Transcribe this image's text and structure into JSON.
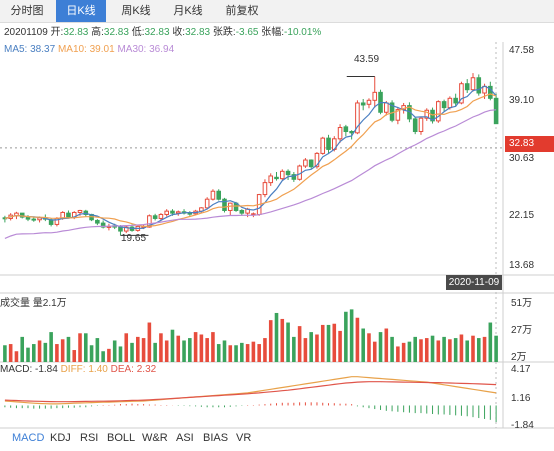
{
  "tabs": [
    "分时图",
    "日K线",
    "周K线",
    "月K线",
    "前复权"
  ],
  "info": {
    "date": "20201109",
    "open_label": "开:",
    "open": "32.83",
    "high_label": "高:",
    "high": "32.83",
    "low_label": "低:",
    "low": "32.83",
    "close_label": "收:",
    "close": "32.83",
    "change_label": "张跌:",
    "change": "-3.65",
    "pct_label": "张幅:",
    "pct": "-10.01%"
  },
  "ma": {
    "ma5": "MA5: 38.37",
    "ma10": "MA10: 39.01",
    "ma30": "MA30: 36.94"
  },
  "price_axis": [
    "47.58",
    "39.10",
    "32.83",
    "30.63",
    "22.15",
    "13.68"
  ],
  "high_marker": "43.59",
  "low_marker": "19.65",
  "date_label": "2020-11-09",
  "volume": {
    "title": "成交量 量2.1万",
    "axis": [
      "51万",
      "27万",
      "2万"
    ]
  },
  "macd": {
    "macd_label": "MACD: -1.84",
    "diff_label": "DIFF: 1.40",
    "dea_label": "DEA: 2.32",
    "axis": [
      "4.17",
      "1.16",
      "-1.84"
    ]
  },
  "indicators": [
    "MACD",
    "KDJ",
    "RSI",
    "BOLL",
    "W&R",
    "ASI",
    "BIAS",
    "VR"
  ],
  "colors": {
    "up": "#e74c3c",
    "down": "#3aa35c",
    "tab_active": "#3d7fd6",
    "ma5": "#4a7fc1",
    "ma10": "#f0a050",
    "ma30": "#b98bd6",
    "current_price": "#e23b2e",
    "date_bg": "#4a4a4a"
  },
  "chart_data": {
    "type": "candlestick",
    "y_range": [
      13.68,
      47.58
    ],
    "candles": [
      [
        22.3,
        22.6,
        21.6,
        22.2
      ],
      [
        22.2,
        23.0,
        21.9,
        22.7
      ],
      [
        22.6,
        23.2,
        22.1,
        23.0
      ],
      [
        23.0,
        23.0,
        22.2,
        22.4
      ],
      [
        22.4,
        22.7,
        21.8,
        22.1
      ],
      [
        22.1,
        22.5,
        21.7,
        22.0
      ],
      [
        22.0,
        22.5,
        21.6,
        22.3
      ],
      [
        22.3,
        22.8,
        21.8,
        22.1
      ],
      [
        22.0,
        22.2,
        21.0,
        21.3
      ],
      [
        21.3,
        22.4,
        21.0,
        22.2
      ],
      [
        22.2,
        23.3,
        22.0,
        23.1
      ],
      [
        23.0,
        23.4,
        22.2,
        22.4
      ],
      [
        22.4,
        23.3,
        22.1,
        23.1
      ],
      [
        23.1,
        23.5,
        22.6,
        23.4
      ],
      [
        23.3,
        23.5,
        22.5,
        22.8
      ],
      [
        22.8,
        22.9,
        21.8,
        22.0
      ],
      [
        21.9,
        22.1,
        21.2,
        21.5
      ],
      [
        21.5,
        21.9,
        20.7,
        20.9
      ],
      [
        20.9,
        21.4,
        20.4,
        21.0
      ],
      [
        21.1,
        21.4,
        20.6,
        20.9
      ],
      [
        20.9,
        21.2,
        19.65,
        20.3
      ],
      [
        20.3,
        21.1,
        20.0,
        20.9
      ],
      [
        20.9,
        21.3,
        20.2,
        20.4
      ],
      [
        20.4,
        21.2,
        20.2,
        21.0
      ],
      [
        21.0,
        21.3,
        20.6,
        21.0
      ],
      [
        20.9,
        22.8,
        20.8,
        22.6
      ],
      [
        22.6,
        22.9,
        21.9,
        22.2
      ],
      [
        22.2,
        23.0,
        21.8,
        22.8
      ],
      [
        22.8,
        23.6,
        22.5,
        23.3
      ],
      [
        23.3,
        23.6,
        22.6,
        23.0
      ],
      [
        23.0,
        23.4,
        22.6,
        23.2
      ],
      [
        23.2,
        23.6,
        22.8,
        23.0
      ],
      [
        23.0,
        23.3,
        22.6,
        22.9
      ],
      [
        22.9,
        23.5,
        22.8,
        23.3
      ],
      [
        23.3,
        23.9,
        23.0,
        23.8
      ],
      [
        23.8,
        25.4,
        23.6,
        25.1
      ],
      [
        25.1,
        26.6,
        24.9,
        26.3
      ],
      [
        26.3,
        26.6,
        24.9,
        25.1
      ],
      [
        25.1,
        25.3,
        23.1,
        23.4
      ],
      [
        23.4,
        24.6,
        22.7,
        24.5
      ],
      [
        24.5,
        24.7,
        23.2,
        23.4
      ],
      [
        23.4,
        23.6,
        22.6,
        23.0
      ],
      [
        23.0,
        23.8,
        22.4,
        23.6
      ],
      [
        22.8,
        23.1,
        22.4,
        22.9
      ],
      [
        22.8,
        25.9,
        22.6,
        25.8
      ],
      [
        25.8,
        28.1,
        25.4,
        27.6
      ],
      [
        27.6,
        29.0,
        27.1,
        28.6
      ],
      [
        28.4,
        29.2,
        27.9,
        28.2
      ],
      [
        28.2,
        29.6,
        28.0,
        29.3
      ],
      [
        29.3,
        29.6,
        28.0,
        28.8
      ],
      [
        28.8,
        29.2,
        27.7,
        28.1
      ],
      [
        28.1,
        30.3,
        27.9,
        30.1
      ],
      [
        30.1,
        31.3,
        29.8,
        31.0
      ],
      [
        31.0,
        31.1,
        29.7,
        30.0
      ],
      [
        30.0,
        32.2,
        29.7,
        32.0
      ],
      [
        32.0,
        34.5,
        31.8,
        34.3
      ],
      [
        34.3,
        34.8,
        31.9,
        32.6
      ],
      [
        32.6,
        34.6,
        32.3,
        34.2
      ],
      [
        34.2,
        36.4,
        33.6,
        35.9
      ],
      [
        36.0,
        36.3,
        34.6,
        35.3
      ],
      [
        35.3,
        35.5,
        34.1,
        35.1
      ],
      [
        35.1,
        40.0,
        34.9,
        39.6
      ],
      [
        39.6,
        40.2,
        38.5,
        39.3
      ],
      [
        39.4,
        40.3,
        38.8,
        40.0
      ],
      [
        40.0,
        43.59,
        38.9,
        41.2
      ],
      [
        41.2,
        41.6,
        37.9,
        38.2
      ],
      [
        38.2,
        39.9,
        37.7,
        39.6
      ],
      [
        39.6,
        40.0,
        36.7,
        37.0
      ],
      [
        37.0,
        39.0,
        36.4,
        38.6
      ],
      [
        38.6,
        39.6,
        38.0,
        39.2
      ],
      [
        39.2,
        39.7,
        36.7,
        37.2
      ],
      [
        37.2,
        37.5,
        34.9,
        35.3
      ],
      [
        35.3,
        37.5,
        34.8,
        37.3
      ],
      [
        37.3,
        38.8,
        36.9,
        38.5
      ],
      [
        38.5,
        38.9,
        36.5,
        36.9
      ],
      [
        36.9,
        40.0,
        36.6,
        39.8
      ],
      [
        39.8,
        40.1,
        38.3,
        38.9
      ],
      [
        38.9,
        40.6,
        38.6,
        40.3
      ],
      [
        40.3,
        41.0,
        39.1,
        39.6
      ],
      [
        39.6,
        42.8,
        39.4,
        42.5
      ],
      [
        42.5,
        43.2,
        41.1,
        41.6
      ],
      [
        41.6,
        44.1,
        41.3,
        43.4
      ],
      [
        43.4,
        43.9,
        40.7,
        41.1
      ],
      [
        41.1,
        42.5,
        40.2,
        42.1
      ],
      [
        42.1,
        42.8,
        40.0,
        40.3
      ],
      [
        40.3,
        41.0,
        36.48,
        36.48
      ]
    ],
    "volume": [
      14,
      15,
      9,
      21,
      12,
      15,
      18,
      16,
      25,
      15,
      19,
      21,
      10,
      24,
      24,
      14,
      20,
      9,
      11,
      18,
      13,
      24,
      16,
      21,
      20,
      33,
      16,
      24,
      18,
      27,
      22,
      18,
      20,
      25,
      23,
      20,
      25,
      15,
      18,
      14,
      14,
      16,
      15,
      17,
      15,
      20,
      35,
      41,
      36,
      33,
      21,
      30,
      20,
      25,
      23,
      31,
      31,
      32,
      26,
      42,
      44,
      37,
      28,
      24,
      17,
      25,
      28,
      21,
      13,
      16,
      17,
      21,
      19,
      20,
      22,
      18,
      21,
      19,
      20,
      23,
      18,
      22,
      20,
      21,
      33,
      22
    ],
    "macd": [
      -0.2,
      -0.25,
      -0.3,
      -0.3,
      -0.3,
      -0.35,
      -0.35,
      -0.35,
      -0.35,
      -0.3,
      -0.3,
      -0.25,
      -0.25,
      -0.2,
      -0.2,
      -0.1,
      -0.05,
      0.05,
      0.05,
      0.08,
      0.15,
      0.15,
      0.2,
      0.15,
      0.15,
      0.1,
      0.1,
      0.05,
      0.05,
      0.02,
      -0.05,
      -0.05,
      -0.08,
      -0.1,
      -0.15,
      -0.2,
      -0.2,
      -0.2,
      -0.2,
      -0.15,
      -0.1,
      -0.05,
      0.05,
      0.05,
      0.1,
      0.15,
      0.2,
      0.25,
      0.3,
      0.3,
      0.3,
      0.35,
      0.35,
      0.35,
      0.35,
      0.3,
      0.25,
      0.25,
      0.2,
      0.2,
      0.15,
      -0.1,
      -0.2,
      -0.3,
      -0.4,
      -0.5,
      -0.6,
      -0.65,
      -0.7,
      -0.75,
      -0.8,
      -0.85,
      -0.85,
      -0.9,
      -0.95,
      -1.0,
      -1.0,
      -1.05,
      -1.1,
      -1.15,
      -1.2,
      -1.3,
      -1.4,
      -1.5,
      -1.6,
      -1.84
    ],
    "diff": [
      0.5,
      0.45,
      0.4,
      0.35,
      0.3,
      0.25,
      0.22,
      0.2,
      0.18,
      0.18,
      0.2,
      0.22,
      0.25,
      0.28,
      0.3,
      0.32,
      0.34,
      0.36,
      0.38,
      0.4,
      0.42,
      0.44,
      0.46,
      0.48,
      0.5,
      0.55,
      0.6,
      0.65,
      0.7,
      0.75,
      0.8,
      0.85,
      0.9,
      0.95,
      1.0,
      1.05,
      1.1,
      1.15,
      1.2,
      1.25,
      1.3,
      1.35,
      1.4,
      1.5,
      1.6,
      1.7,
      1.8,
      1.9,
      2.0,
      2.1,
      2.2,
      2.3,
      2.4,
      2.5,
      2.6,
      2.7,
      2.8,
      2.9,
      3.0,
      3.1,
      3.2,
      3.2,
      3.15,
      3.1,
      3.05,
      3.0,
      2.95,
      2.9,
      2.85,
      2.8,
      2.75,
      2.7,
      2.65,
      2.6,
      2.5,
      2.4,
      2.3,
      2.2,
      2.1,
      2.0,
      1.9,
      1.8,
      1.7,
      1.6,
      1.5,
      1.4
    ],
    "dea": [
      0.6,
      0.58,
      0.55,
      0.52,
      0.5,
      0.48,
      0.46,
      0.44,
      0.43,
      0.42,
      0.42,
      0.42,
      0.43,
      0.44,
      0.45,
      0.46,
      0.47,
      0.48,
      0.49,
      0.5,
      0.52,
      0.54,
      0.56,
      0.58,
      0.6,
      0.63,
      0.66,
      0.7,
      0.74,
      0.78,
      0.82,
      0.86,
      0.9,
      0.94,
      0.98,
      1.02,
      1.06,
      1.1,
      1.14,
      1.18,
      1.22,
      1.26,
      1.3,
      1.35,
      1.4,
      1.46,
      1.52,
      1.58,
      1.64,
      1.7,
      1.78,
      1.86,
      1.94,
      2.02,
      2.1,
      2.18,
      2.26,
      2.34,
      2.42,
      2.5,
      2.55,
      2.6,
      2.62,
      2.64,
      2.64,
      2.64,
      2.63,
      2.62,
      2.61,
      2.6,
      2.59,
      2.58,
      2.57,
      2.56,
      2.55,
      2.54,
      2.52,
      2.5,
      2.48,
      2.46,
      2.44,
      2.42,
      2.4,
      2.38,
      2.35,
      2.32
    ]
  }
}
